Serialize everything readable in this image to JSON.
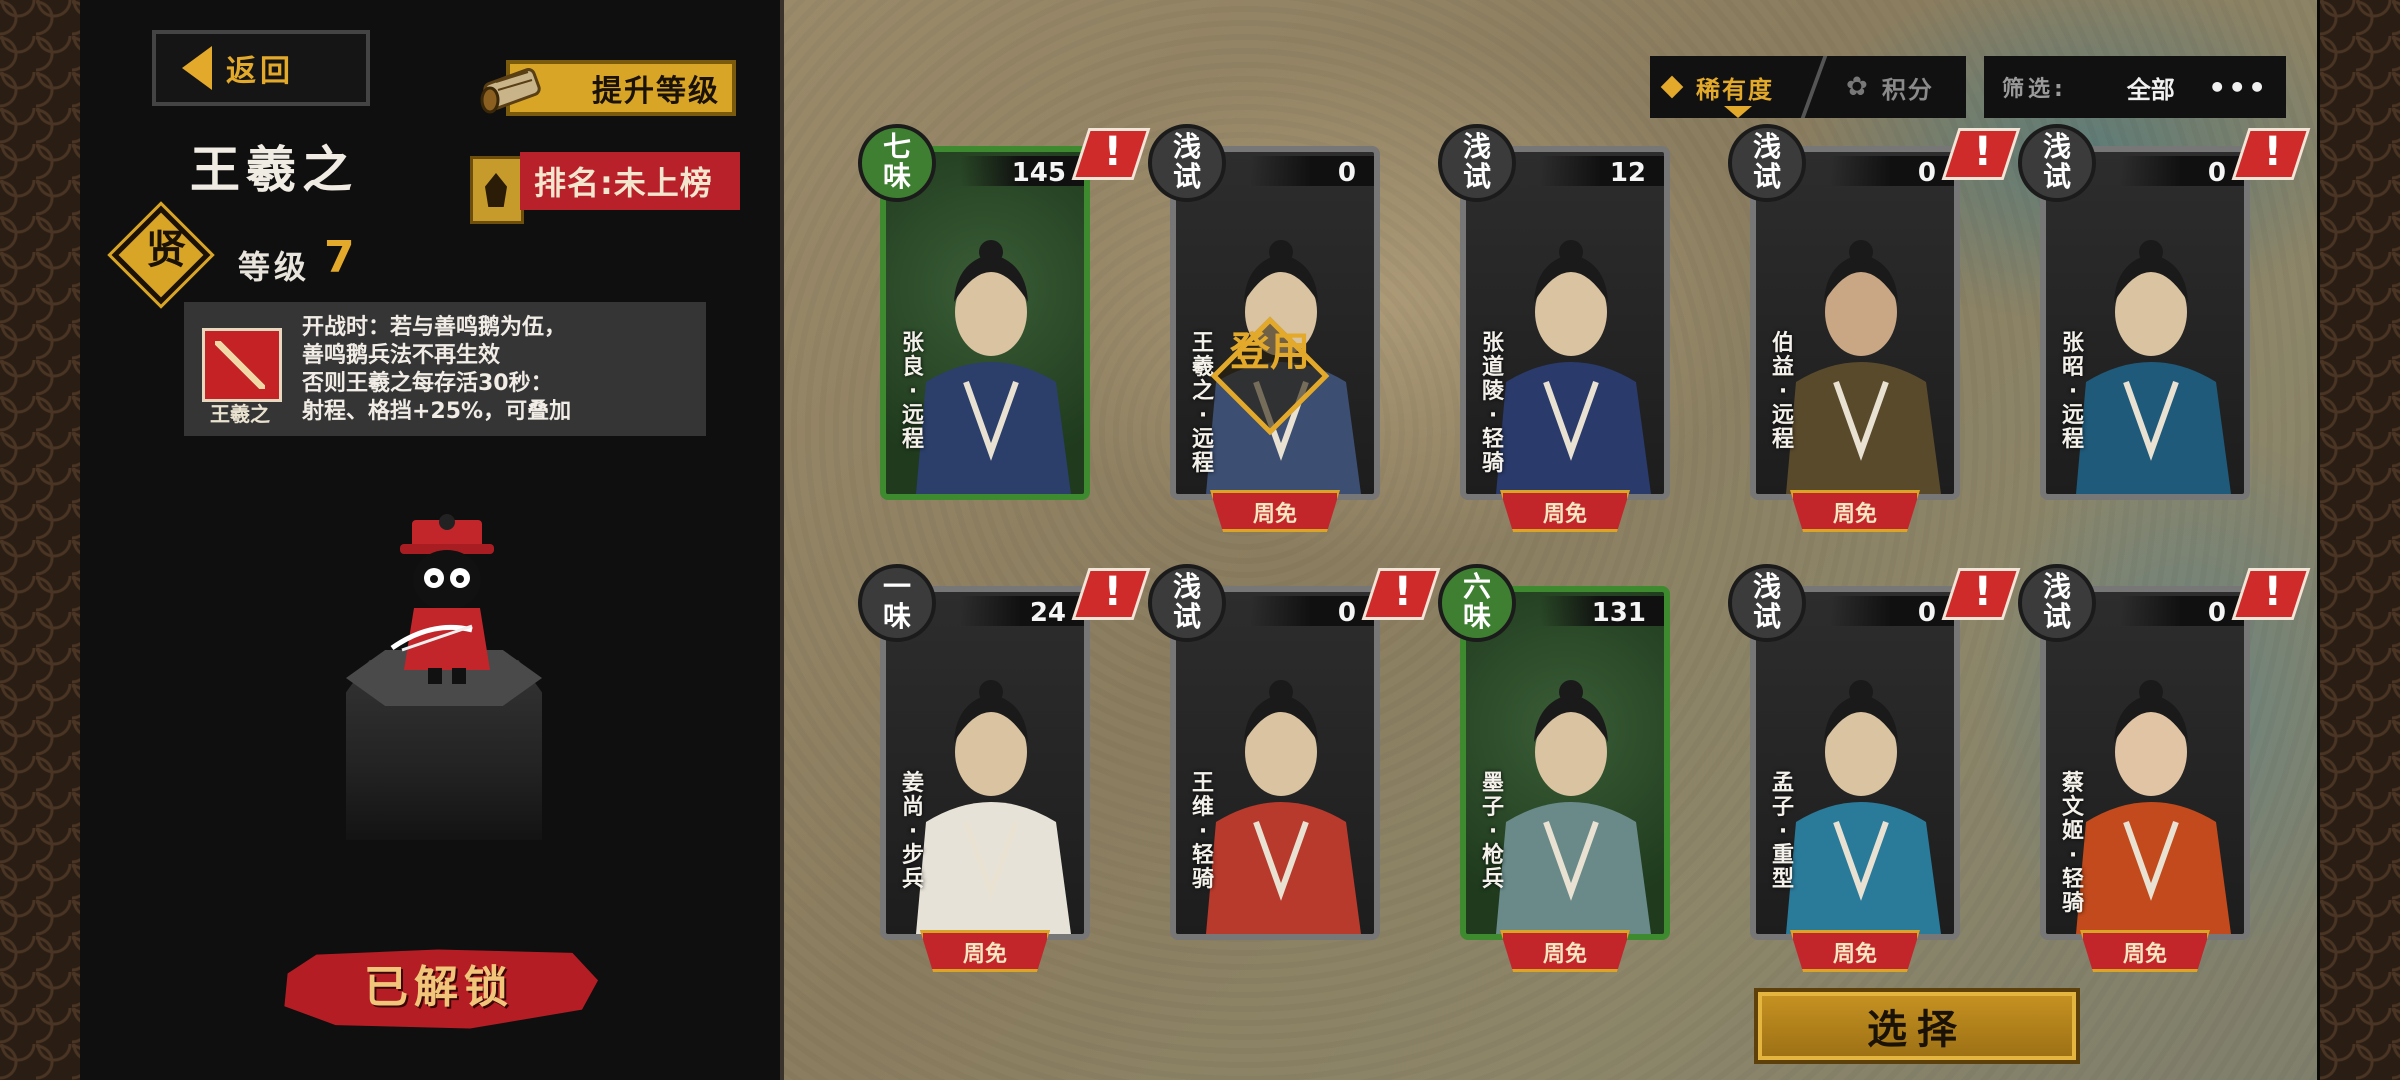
{
  "left_panel": {
    "back_label": "返回",
    "upgrade_label": "提升等级",
    "hero_name": "王羲之",
    "rarity_char": "贤",
    "level_label": "等级",
    "level_value": "7",
    "rank_label": "排名:未上榜",
    "skill": {
      "icon_label": "王羲之",
      "lines": [
        "开战时：若与善鸣鹅为伍，",
        "善鸣鹅兵法不再生效",
        "否则王羲之每存活30秒：",
        "射程、格挡+25%，可叠加"
      ]
    },
    "unlock_label": "已解锁"
  },
  "sort": {
    "rarity_label": "稀有度",
    "points_label": "积分",
    "active": "rarity"
  },
  "filter": {
    "label": "筛选:",
    "value": "全部",
    "more": "•••"
  },
  "cards": [
    {
      "tier": "七味",
      "count": "145",
      "name": "张良·远程",
      "ribbon": "",
      "alert": true,
      "green": true,
      "stamp": ""
    },
    {
      "tier": "浅试",
      "count": "0",
      "name": "王羲之·远程",
      "ribbon": "周免",
      "alert": false,
      "green": false,
      "stamp": "登用"
    },
    {
      "tier": "浅试",
      "count": "12",
      "name": "张道陵·轻骑",
      "ribbon": "周免",
      "alert": false,
      "green": false,
      "stamp": ""
    },
    {
      "tier": "浅试",
      "count": "0",
      "name": "伯益·远程",
      "ribbon": "周免",
      "alert": true,
      "green": false,
      "stamp": ""
    },
    {
      "tier": "浅试",
      "count": "0",
      "name": "张昭·远程",
      "ribbon": "",
      "alert": true,
      "green": false,
      "stamp": ""
    },
    {
      "tier": "一味",
      "count": "24",
      "name": "姜尚·步兵",
      "ribbon": "周免",
      "alert": true,
      "green": false,
      "stamp": ""
    },
    {
      "tier": "浅试",
      "count": "0",
      "name": "王维·轻骑",
      "ribbon": "",
      "alert": true,
      "green": false,
      "stamp": ""
    },
    {
      "tier": "六味",
      "count": "131",
      "name": "墨子·枪兵",
      "ribbon": "周免",
      "alert": false,
      "green": true,
      "stamp": ""
    },
    {
      "tier": "浅试",
      "count": "0",
      "name": "孟子·重型",
      "ribbon": "周免",
      "alert": true,
      "green": false,
      "stamp": ""
    },
    {
      "tier": "浅试",
      "count": "0",
      "name": "蔡文姬·轻骑",
      "ribbon": "周免",
      "alert": true,
      "green": false,
      "stamp": ""
    }
  ],
  "select_label": "选择",
  "colors": {
    "accent_gold": "#e3a92b",
    "ribbon_red": "#c2262b",
    "alert_red": "#d02b2b",
    "card_green": "#3d8a2f"
  }
}
